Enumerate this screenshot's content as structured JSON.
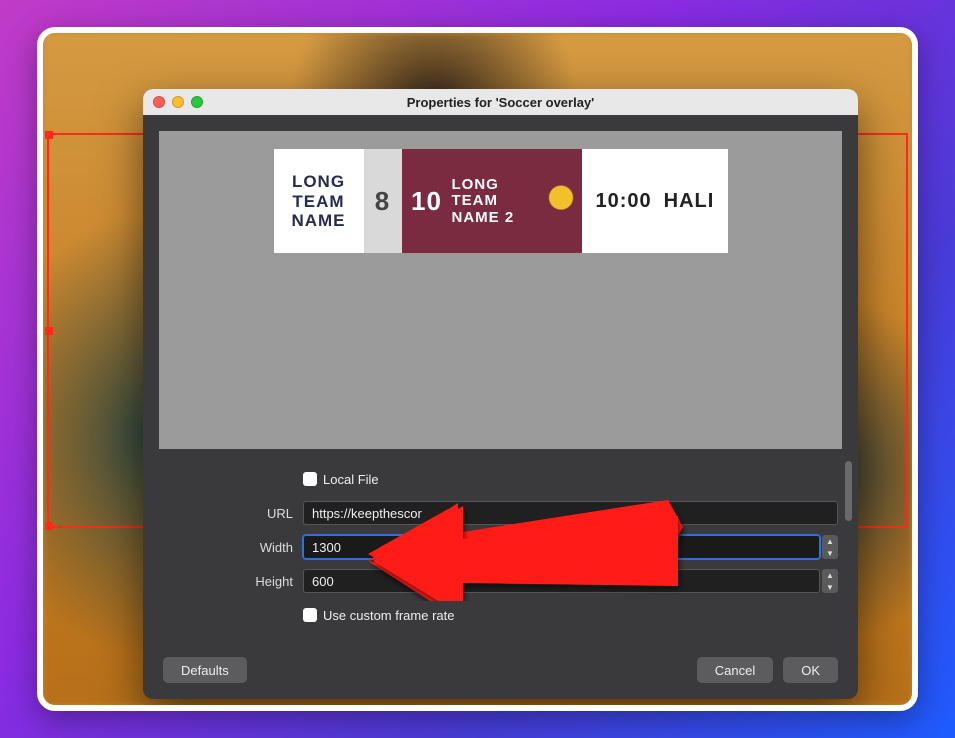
{
  "frame": {
    "selection_color": "#ff2a1a"
  },
  "dialog": {
    "title": "Properties for 'Soccer overlay'",
    "preview": {
      "team1_name": "LONG TEAM NAME",
      "score1": "8",
      "score2": "10",
      "team2_name": "LONG TEAM NAME 2",
      "crest_icon": "shield-icon",
      "time": "10:00",
      "period": "HALI"
    },
    "form": {
      "local_file_label": "Local File",
      "local_file_checked": false,
      "url_label": "URL",
      "url_value": "https://keepthescor",
      "width_label": "Width",
      "width_value": "1300",
      "height_label": "Height",
      "height_value": "600",
      "custom_fps_label": "Use custom frame rate",
      "custom_fps_checked": false
    },
    "buttons": {
      "defaults": "Defaults",
      "cancel": "Cancel",
      "ok": "OK"
    }
  }
}
